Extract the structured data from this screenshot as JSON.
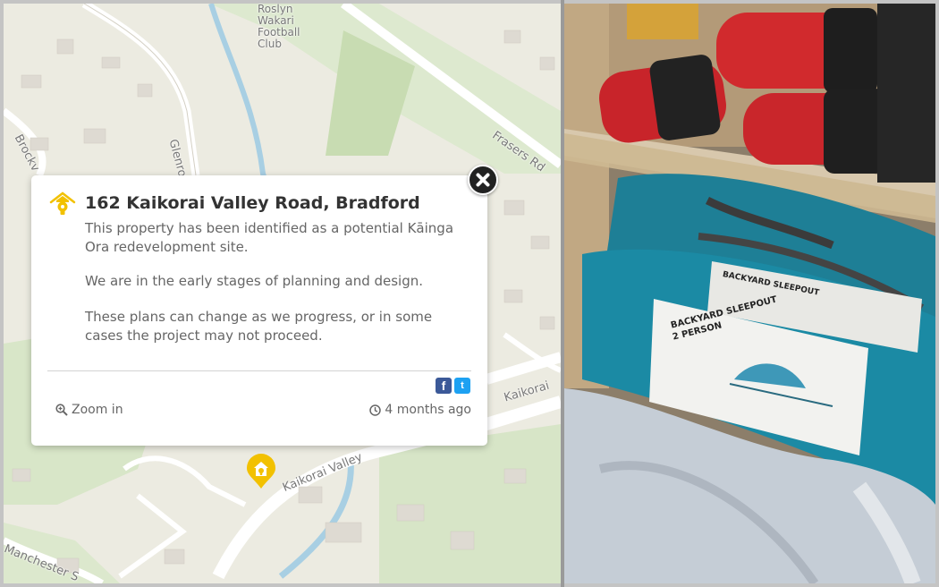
{
  "map": {
    "labels": {
      "club": "Roslyn\nWakari\nFootball\nClub",
      "glenross": "Glenross",
      "brockville": "Brockv",
      "frasers": "Frasers Rd",
      "kaikorai_1": "Kaikorai",
      "kaikorai_2": "Kaikorai Valley",
      "manchester": "Manchester S"
    },
    "accent_color": "#f2c100"
  },
  "popup": {
    "icon": "house-lightbulb-icon",
    "title": "162 Kaikorai Valley Road, Bradford",
    "paragraphs": [
      "This property has been identified as a potential Kāinga Ora redevelopment site.",
      "We are in the early stages of planning and design.",
      "These plans can change as we progress, or in some cases the project may not proceed."
    ],
    "zoom_label": "Zoom in",
    "time_label": "4 months ago",
    "share": {
      "facebook_glyph": "f",
      "twitter_glyph": "t"
    }
  },
  "photo": {
    "label_line1": "BACKYARD SLEEPOUT",
    "label_line2": "2 PERSON",
    "rear_label": "BACKYARD SLEEPOUT"
  }
}
